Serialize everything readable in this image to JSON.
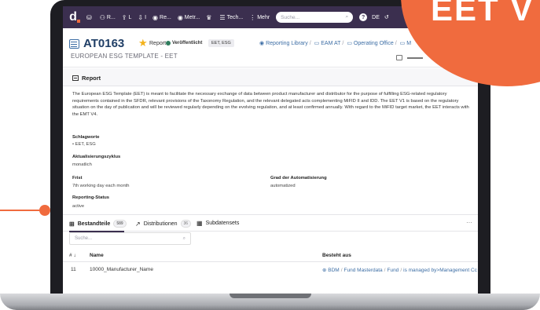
{
  "brand": {
    "logo_letter": "d",
    "accent": "#f06b3e",
    "nav_bg": "#3b2f4f",
    "link": "#3d6ea5"
  },
  "overlay": {
    "badge_text": "EET V"
  },
  "nav": {
    "items": [
      {
        "icon": "database-icon",
        "label": ""
      },
      {
        "icon": "users-icon",
        "label": "R..."
      },
      {
        "icon": "upload-icon",
        "label": "L"
      },
      {
        "icon": "download-icon",
        "label": "I"
      },
      {
        "icon": "eye-icon",
        "label": "Re..."
      },
      {
        "icon": "eye-icon",
        "label": "Metr..."
      },
      {
        "icon": "trophy-icon",
        "label": ""
      },
      {
        "icon": "list-icon",
        "label": "Tech..."
      },
      {
        "icon": "more-vertical-icon",
        "label": "Mehr"
      }
    ],
    "search_placeholder": "Suche...",
    "language": "DE"
  },
  "header": {
    "code": "AT0163",
    "type": "Report",
    "status": "Veröffentlicht",
    "tag": "EET, ESG",
    "subtitle": "EUROPEAN ESG TEMPLATE - EET",
    "breadcrumbs": [
      "Reporting Library",
      "EAM AT",
      "Operating Office",
      "M"
    ]
  },
  "report": {
    "title": "Report",
    "description": "The European ESG Template (EET) is meant to facilitate the necessary exchange of data between product manufacturer and distributor for the purpose of fulfilling ESG-related regulatory requirements contained in the SFDR, relevant provisions of the Taxonomy Regulation, and the relevant delegated acts complementing MiFID II and IDD. The EET V1 is based on the regulatory situation on the day of publication and will be reviewed regularly depending on the evolving regulation, and at least confirmed annually. With regard to the MiFID target market, the EET interacts with the EMT V4.",
    "keywords_label": "Schlagworte",
    "keywords": "EET, ESG",
    "cycle_label": "Aktualisierungszyklus",
    "cycle": "monatlich",
    "deadline_label": "Frist",
    "deadline": "7th working day each month",
    "automation_label": "Grad der Automatisierung",
    "automation": "automatized",
    "status_label": "Reporting-Status",
    "status": "active"
  },
  "tabs": [
    {
      "label": "Bestandteile",
      "count": "589",
      "icon": "grid-icon",
      "active": true
    },
    {
      "label": "Distributionen",
      "count": "36",
      "icon": "external-link-icon",
      "active": false
    },
    {
      "label": "Subdatensets",
      "count": "",
      "icon": "table-icon",
      "active": false
    }
  ],
  "table": {
    "search_placeholder": "Suche...",
    "headers": {
      "num": "#",
      "name": "Name",
      "consists": "Besteht aus"
    },
    "rows": [
      {
        "num": "11",
        "name": "10000_Manufacturer_Name",
        "path": [
          "BDM",
          "Fund Masterdata",
          "Fund",
          "is managed by>Management Cc"
        ]
      }
    ]
  }
}
